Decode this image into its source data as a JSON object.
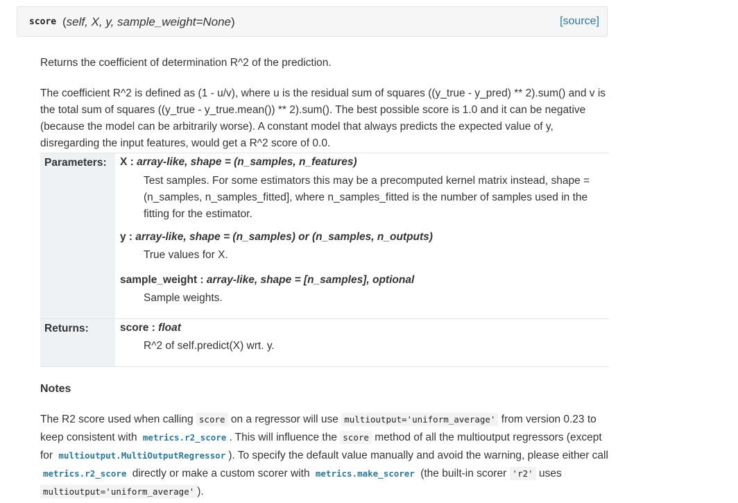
{
  "signature": {
    "name": "score",
    "params": "self, X, y, sample_weight=None",
    "source_link": "[source]"
  },
  "summary": "Returns the coefficient of determination R^2 of the prediction.",
  "description": "The coefficient R^2 is defined as (1 - u/v), where u is the residual sum of squares ((y_true - y_pred) ** 2).sum() and v is the total sum of squares ((y_true - y_true.mean()) ** 2).sum(). The best possible score is 1.0 and it can be negative (because the model can be arbitrarily worse). A constant model that always predicts the expected value of y, disregarding the input features, would get a R^2 score of 0.0.",
  "parameters": {
    "label": "Parameters:",
    "items": [
      {
        "name": "X",
        "type": "array-like, shape = (n_samples, n_features)",
        "desc": "Test samples. For some estimators this may be a precomputed kernel matrix instead, shape = (n_samples, n_samples_fitted], where n_samples_fitted is the number of samples used in the fitting for the estimator."
      },
      {
        "name": "y",
        "type": "array-like, shape = (n_samples) or (n_samples, n_outputs)",
        "desc": "True values for X."
      },
      {
        "name": "sample_weight",
        "type": "array-like, shape = [n_samples], optional",
        "desc": "Sample weights."
      }
    ]
  },
  "returns": {
    "label": "Returns:",
    "name": "score",
    "type": "float",
    "desc": "R^2 of self.predict(X) wrt. y."
  },
  "notes": {
    "heading": "Notes",
    "t1": "The R2 score used when calling",
    "c1": "score",
    "t2": "on a regressor will use",
    "c2": "multioutput='uniform_average'",
    "t3": "from version 0.23 to keep consistent with",
    "c3": "metrics.r2_score",
    "t4": ". This will influence the",
    "c4": "score",
    "t5": "method of all the multioutput regressors (except for",
    "c5": "multioutput.MultiOutputRegressor",
    "t6": "). To specify the default value manually and avoid the warning, please either call",
    "c6": "metrics.r2_score",
    "t7": "directly or make a custom scorer with",
    "c7": "metrics.make_scorer",
    "t8": "(the built-in scorer",
    "c8": "'r2'",
    "t9": "uses",
    "c9": "multioutput='uniform_average'",
    "t10": ")."
  }
}
